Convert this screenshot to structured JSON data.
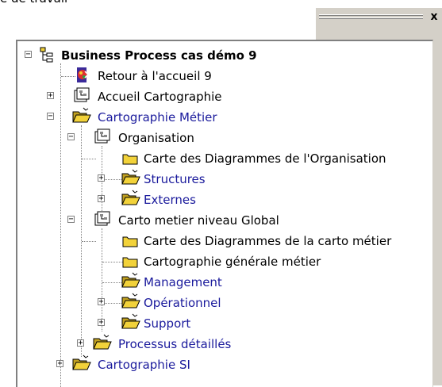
{
  "window": {
    "title_fragment": "e de travail",
    "close_label": "x"
  },
  "tree": {
    "root": "Business Process cas démo 9",
    "items": [
      {
        "label": "Retour à l'accueil 9",
        "icon": "app-home-icon"
      },
      {
        "label": "Accueil Cartographie",
        "icon": "diagram-folder-icon"
      },
      {
        "label": "Cartographie Métier",
        "icon": "open-folder-icon"
      },
      {
        "label": "Organisation",
        "icon": "diagram-folder-icon"
      },
      {
        "label": "Carte des Diagrammes de l'Organisation",
        "icon": "map-card-icon"
      },
      {
        "label": "Structures",
        "icon": "open-folder-icon"
      },
      {
        "label": "Externes",
        "icon": "open-folder-icon"
      },
      {
        "label": "Carto metier niveau Global",
        "icon": "diagram-folder-icon"
      },
      {
        "label": "Carte des Diagrammes de la carto métier",
        "icon": "map-card-icon"
      },
      {
        "label": "Cartographie générale métier",
        "icon": "map-card-icon"
      },
      {
        "label": "Management",
        "icon": "open-folder-icon"
      },
      {
        "label": "Opérationnel",
        "icon": "open-folder-icon"
      },
      {
        "label": "Support",
        "icon": "open-folder-icon"
      },
      {
        "label": "Processus détaillés",
        "icon": "open-folder-icon"
      },
      {
        "label": "Cartographie SI",
        "icon": "open-folder-icon"
      }
    ],
    "colors": {
      "link": "#1a1a9c",
      "text": "#000000",
      "folder": "#f2d23a"
    }
  }
}
